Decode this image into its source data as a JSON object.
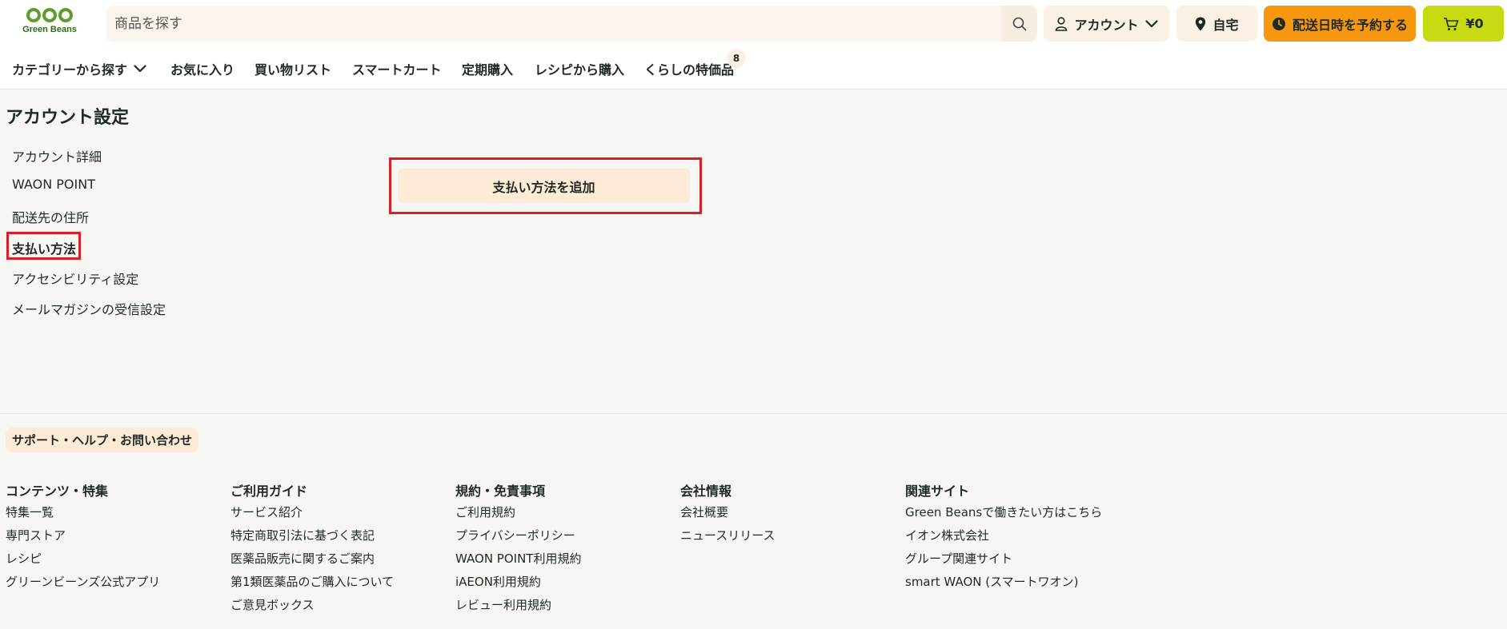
{
  "logo": {
    "text": "Green Beans"
  },
  "search": {
    "placeholder": "商品を探す"
  },
  "header": {
    "account_label": "アカウント",
    "home_label": "自宅",
    "reserve_label": "配送日時を予約する",
    "cart_label": "¥0"
  },
  "nav": {
    "items": [
      {
        "label": "カテゴリーから探す"
      },
      {
        "label": "お気に入り"
      },
      {
        "label": "買い物リスト"
      },
      {
        "label": "スマートカート"
      },
      {
        "label": "定期購入"
      },
      {
        "label": "レシピから購入"
      },
      {
        "label": "くらしの特価品"
      }
    ],
    "badge": "8"
  },
  "account": {
    "title": "アカウント設定",
    "sidebar": [
      {
        "label": "アカウント詳細"
      },
      {
        "label": "WAON POINT"
      },
      {
        "label": "配送先の住所"
      },
      {
        "label": "支払い方法"
      },
      {
        "label": "アクセシビリティ設定"
      },
      {
        "label": "メールマガジンの受信設定"
      }
    ],
    "add_payment_label": "支払い方法を追加"
  },
  "footer": {
    "support_label": "サポート・ヘルプ・お問い合わせ",
    "columns": [
      {
        "title": "コンテンツ・特集",
        "links": [
          "特集一覧",
          "専門ストア",
          "レシピ",
          "グリーンビーンズ公式アプリ"
        ]
      },
      {
        "title": "ご利用ガイド",
        "links": [
          "サービス紹介",
          "特定商取引法に基づく表記",
          "医薬品販売に関するご案内",
          "第1類医薬品のご購入について",
          "ご意見ボックス"
        ]
      },
      {
        "title": "規約・免責事項",
        "links": [
          "ご利用規約",
          "プライバシーポリシー",
          "WAON POINT利用規約",
          "iAEON利用規約",
          "レビュー利用規約"
        ]
      },
      {
        "title": "会社情報",
        "links": [
          "会社概要",
          "ニュースリリース"
        ]
      },
      {
        "title": "関連サイト",
        "links": [
          "Green Beansで働きたい方はこちら",
          "イオン株式会社",
          "グループ関連サイト",
          "smart WAON (スマートワオン)"
        ]
      }
    ]
  },
  "colors": {
    "reserve": "#f5980f",
    "cart": "#c8da12",
    "highlight": "#d9202a",
    "brand": "#5f9c2a"
  }
}
